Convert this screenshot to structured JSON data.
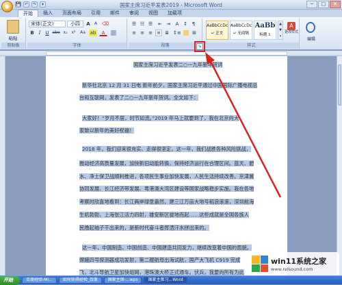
{
  "window": {
    "title": "国家主席习近平发表2019 - Microsoft Word"
  },
  "quick_access": [
    "💾",
    "↶",
    "↷",
    "▾"
  ],
  "window_controls": {
    "min": "─",
    "max": "□",
    "close": "✕"
  },
  "tabs": [
    "开始",
    "插入",
    "页面布局",
    "引用",
    "邮件",
    "审阅",
    "视图",
    "加载项"
  ],
  "ribbon": {
    "clipboard": {
      "label": "剪贴板",
      "paste": "粘贴"
    },
    "font": {
      "label": "字体",
      "font_name": "宋体(正文)",
      "font_size": "小四",
      "bold": "B",
      "italic": "I",
      "underline": "U",
      "strike": "abe",
      "sub": "x₂",
      "sup": "x²",
      "case": "Aa",
      "color": "A",
      "grow": "A",
      "shrink": "A"
    },
    "paragraph": {
      "label": "段落"
    },
    "styles": {
      "label": "样式",
      "items": [
        {
          "preview": "AaBbCcDc",
          "name": "↵ 正文"
        },
        {
          "preview": "AaBbCcDc",
          "name": "↵ 无间隔"
        },
        {
          "preview": "AaBb",
          "name": "标题 1"
        }
      ],
      "change": "更改样式",
      "editing": "编辑"
    },
    "launcher": "↘"
  },
  "document": {
    "lines": [
      "国家主席习近平发表二○一九年新年贺词",
      "新华社北京 12 月 31 日电  新年前夕，国家主席习近平通过中国国际广播电视总",
      "台和互联网，发表了二○一九年新年贺词。全文如下：",
      "大家好！“岁月不居，时节如流。”2019 年马上就要到了，我在北京向大",
      "家致以新年的美好祝福！",
      "2018 年，我们迎来很充实、走得很坚定。这一年，我们战胜各种风险挑战，",
      "推动经济高质量发展，加快新旧动能转换，保持经济运行在合理区间。蓝天、碧",
      "水、净土保卫战顺利推进，各项民生事业加快发展，人民生活持续改善。京津冀",
      "协同发展、长江经济带发展、粤港澳大湾区建设等国家战略稳步实施。我在各地",
      "考察时欣喜地看到：长江两岸绿意盎然，建三江万亩大地号稻浪滚滚，深圳前海",
      "生机勃勃，上海张江活力四射，雄安新区拔地而起……这些成就是全国各族人",
      "民撸起袖子干出来的，是新时代奋斗者挥洒汗水拼出来的。",
      "这一年，中国制造、中国创造、中国建造共同发力，继续改变着中国的面貌。",
      "嫦娥四号探测器成功发射，第二艘航母出海试航，国产大飞机 C919 完成",
      "飞，北斗导航卫星加快组网，港珠澳大桥正式通车。伏兵，我要向所有为此"
    ]
  },
  "taskbar": {
    "start": "开始",
    "items": [
      "百度经验-Mi...",
      "如何获得经验_百度",
      "国家主席-...wps",
      "国家主席习...Word"
    ]
  },
  "watermark": {
    "brand": "win11系统之家",
    "url": "www.relsound.com"
  }
}
